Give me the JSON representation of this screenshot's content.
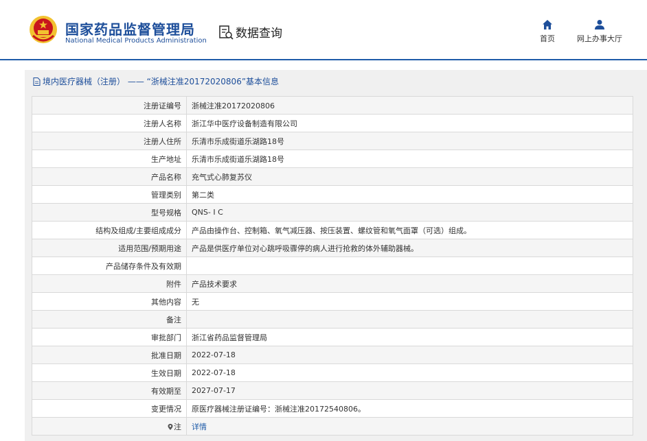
{
  "header": {
    "org_cn": "国家药品监督管理局",
    "org_en": "National Medical Products Administration",
    "section": "数据查询",
    "nav": [
      {
        "label": "首页",
        "icon": "home-icon"
      },
      {
        "label": "网上办事大厅",
        "icon": "user-icon"
      }
    ]
  },
  "breadcrumb": {
    "text": "境内医疗器械（注册） —— “浙械注准20172020806”基本信息",
    "icon": "document-icon"
  },
  "details": [
    {
      "label": "注册证编号",
      "value": "浙械注准20172020806"
    },
    {
      "label": "注册人名称",
      "value": "浙江华中医疗设备制造有限公司"
    },
    {
      "label": "注册人住所",
      "value": "乐清市乐成街道乐湖路18号"
    },
    {
      "label": "生产地址",
      "value": "乐清市乐成街道乐湖路18号"
    },
    {
      "label": "产品名称",
      "value": "充气式心肺复苏仪"
    },
    {
      "label": "管理类别",
      "value": "第二类"
    },
    {
      "label": "型号规格",
      "value": "QNS- I C"
    },
    {
      "label": "结构及组成/主要组成成分",
      "value": "产品由操作台、控制箱、氧气减压器、按压装置、螺纹管和氧气面罩（可选）组成。"
    },
    {
      "label": "适用范围/预期用途",
      "value": "产品是供医疗单位对心跳呼吸骤停的病人进行抢救的体外辅助器械。"
    },
    {
      "label": "产品储存条件及有效期",
      "value": ""
    },
    {
      "label": "附件",
      "value": "产品技术要求"
    },
    {
      "label": "其他内容",
      "value": "无"
    },
    {
      "label": "备注",
      "value": ""
    },
    {
      "label": "审批部门",
      "value": "浙江省药品监督管理局"
    },
    {
      "label": "批准日期",
      "value": "2022-07-18"
    },
    {
      "label": "生效日期",
      "value": "2022-07-18"
    },
    {
      "label": "有效期至",
      "value": "2027-07-17"
    },
    {
      "label": "变更情况",
      "value": "原医疗器械注册证编号：浙械注准20172540806。"
    }
  ],
  "note": {
    "label": "注",
    "link": "详情"
  },
  "colors": {
    "brand": "#1d4e9a",
    "link": "#1d5aa8",
    "emblem_red": "#c8161d",
    "emblem_gold": "#f2c230"
  }
}
